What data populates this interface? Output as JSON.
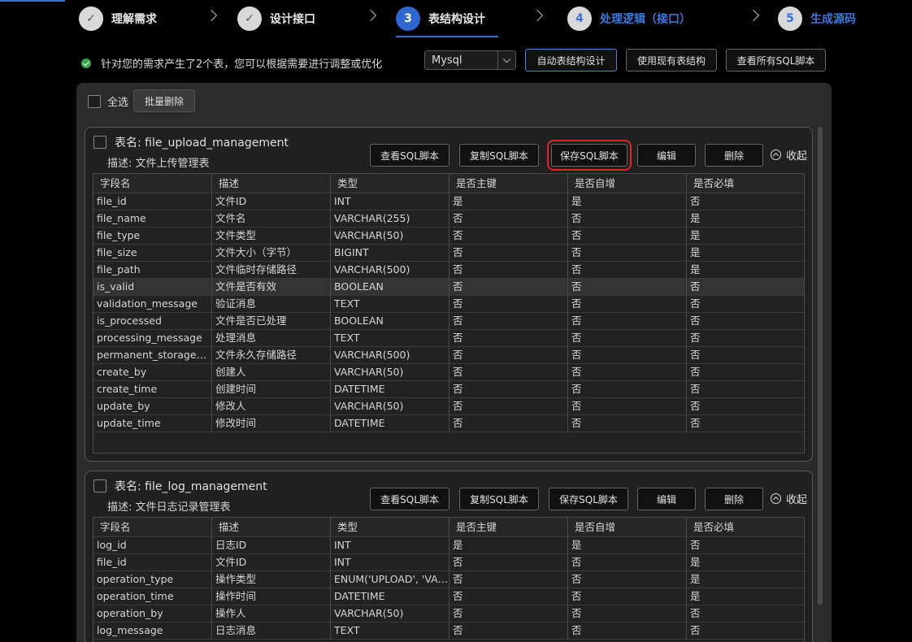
{
  "steps": [
    {
      "num": "✓",
      "label": "理解需求"
    },
    {
      "num": "✓",
      "label": "设计接口"
    },
    {
      "num": "3",
      "label": "表结构设计"
    },
    {
      "num": "4",
      "label": "处理逻辑（接口）"
    },
    {
      "num": "5",
      "label": "生成源码"
    }
  ],
  "toolbar": {
    "notice": "针对您的需求产生了2个表，您可以根据需要进行调整或优化",
    "db_type": "Mysql",
    "auto_design": "自动表结构设计",
    "use_existing": "使用现有表结构",
    "view_all_sql": "查看所有SQL脚本"
  },
  "panel": {
    "select_all": "全选",
    "bulk_delete": "批量删除"
  },
  "card_actions": {
    "view_sql": "查看SQL脚本",
    "copy_sql": "复制SQL脚本",
    "save_sql": "保存SQL脚本",
    "edit": "编辑",
    "delete": "删除",
    "collapse": "收起"
  },
  "columns": [
    "字段名",
    "描述",
    "类型",
    "是否主键",
    "是否自增",
    "是否必填"
  ],
  "tables": [
    {
      "name": "表名: file_upload_management",
      "desc": "描述: 文件上传管理表",
      "rows": [
        [
          "file_id",
          "文件ID",
          "INT",
          "是",
          "是",
          "否"
        ],
        [
          "file_name",
          "文件名",
          "VARCHAR(255)",
          "否",
          "否",
          "是"
        ],
        [
          "file_type",
          "文件类型",
          "VARCHAR(50)",
          "否",
          "否",
          "是"
        ],
        [
          "file_size",
          "文件大小（字节）",
          "BIGINT",
          "否",
          "否",
          "是"
        ],
        [
          "file_path",
          "文件临时存储路径",
          "VARCHAR(500)",
          "否",
          "否",
          "是"
        ],
        [
          "is_valid",
          "文件是否有效",
          "BOOLEAN",
          "否",
          "否",
          "否"
        ],
        [
          "validation_message",
          "验证消息",
          "TEXT",
          "否",
          "否",
          "否"
        ],
        [
          "is_processed",
          "文件是否已处理",
          "BOOLEAN",
          "否",
          "否",
          "否"
        ],
        [
          "processing_message",
          "处理消息",
          "TEXT",
          "否",
          "否",
          "否"
        ],
        [
          "permanent_storage_p...",
          "文件永久存储路径",
          "VARCHAR(500)",
          "否",
          "否",
          "否"
        ],
        [
          "create_by",
          "创建人",
          "VARCHAR(50)",
          "否",
          "否",
          "否"
        ],
        [
          "create_time",
          "创建时间",
          "DATETIME",
          "否",
          "否",
          "否"
        ],
        [
          "update_by",
          "修改人",
          "VARCHAR(50)",
          "否",
          "否",
          "否"
        ],
        [
          "update_time",
          "修改时间",
          "DATETIME",
          "否",
          "否",
          "否"
        ]
      ]
    },
    {
      "name": "表名: file_log_management",
      "desc": "描述: 文件日志记录管理表",
      "rows": [
        [
          "log_id",
          "日志ID",
          "INT",
          "是",
          "是",
          "否"
        ],
        [
          "file_id",
          "文件ID",
          "INT",
          "否",
          "否",
          "是"
        ],
        [
          "operation_type",
          "操作类型",
          "ENUM('UPLOAD', 'VAL...",
          "否",
          "否",
          "是"
        ],
        [
          "operation_time",
          "操作时间",
          "DATETIME",
          "否",
          "否",
          "是"
        ],
        [
          "operation_by",
          "操作人",
          "VARCHAR(50)",
          "否",
          "否",
          "否"
        ],
        [
          "log_message",
          "日志消息",
          "TEXT",
          "否",
          "否",
          "否"
        ]
      ]
    }
  ]
}
